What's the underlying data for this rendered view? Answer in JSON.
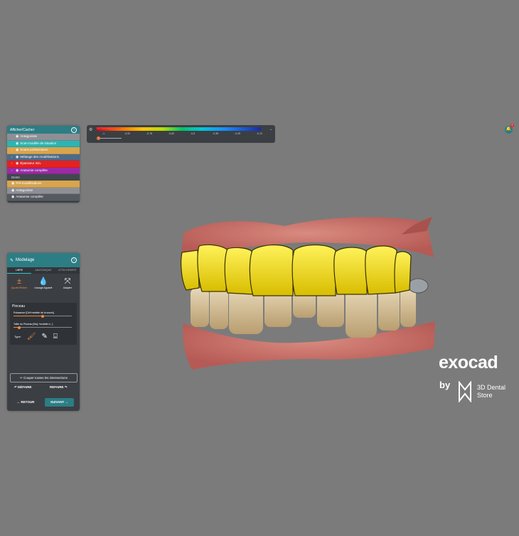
{
  "visibility_panel": {
    "title": "Afficher/Cacher",
    "groups": [
      {
        "label": "Antagoniste",
        "color": "#8e8f95",
        "expand": false
      },
      {
        "label": "Scan-modèle de situation",
        "color": "#2bb5b3",
        "expand": false
      },
      {
        "label": "Scans préliminaires",
        "color": "#d8a44e",
        "expand": true
      },
      {
        "label": "Mélange des modélisations",
        "color": "#4f6a88",
        "expand": true
      },
      {
        "label": "Épaisseur min.",
        "color": "#e82020",
        "expand": true
      },
      {
        "label": "Anatomie complète",
        "color": "#9a2ba6",
        "expand": true
      }
    ],
    "subsection": "Dents",
    "sub_groups": [
      {
        "label": "Pré-modélisations",
        "color": "#d8a44e"
      },
      {
        "label": "Antagoniste",
        "color": "#8e8f95"
      },
      {
        "label": "Anatomie complète",
        "color": "#555a60"
      }
    ]
  },
  "colorbar": {
    "title": "INTERSECTION",
    "ticks": [
      "-1",
      "-0,92",
      "-0,78",
      "-0,62",
      "-0,5",
      "-0,38",
      "-0,25",
      "-0,12"
    ]
  },
  "modelage_panel": {
    "title": "Modelage",
    "tabs": [
      "LIBRE",
      "ANATOMIQUE",
      "ATTACHEMENT"
    ],
    "tools": [
      {
        "label": "Ajouter/Retirer",
        "icon": "±"
      },
      {
        "label": "Lissage Apparié",
        "icon": "💧"
      },
      {
        "label": "Adapter",
        "icon": "⤧"
      }
    ],
    "pinceau": {
      "title": "Pinceau",
      "strength_label": "Puissance [Ctrl+molette de la souris]",
      "strength_value": 0.5,
      "size_label": "Taille du Pinceau [Maj.+molette d...]",
      "size_value": 0.1,
      "type_label": "Type:"
    },
    "cut_label": "Couper toutes les intersections",
    "undo_label": "DÉFAIRE",
    "redo_label": "REFAIRE",
    "back_label": "RETOUR",
    "next_label": "SUIVANT",
    "accent": "#2c7d84",
    "active": "#f08a3a"
  },
  "logo": {
    "word": "exocad",
    "by": "by",
    "store_line1": "3D Dental",
    "store_line2": "Store"
  },
  "notification": {
    "count": "1"
  }
}
